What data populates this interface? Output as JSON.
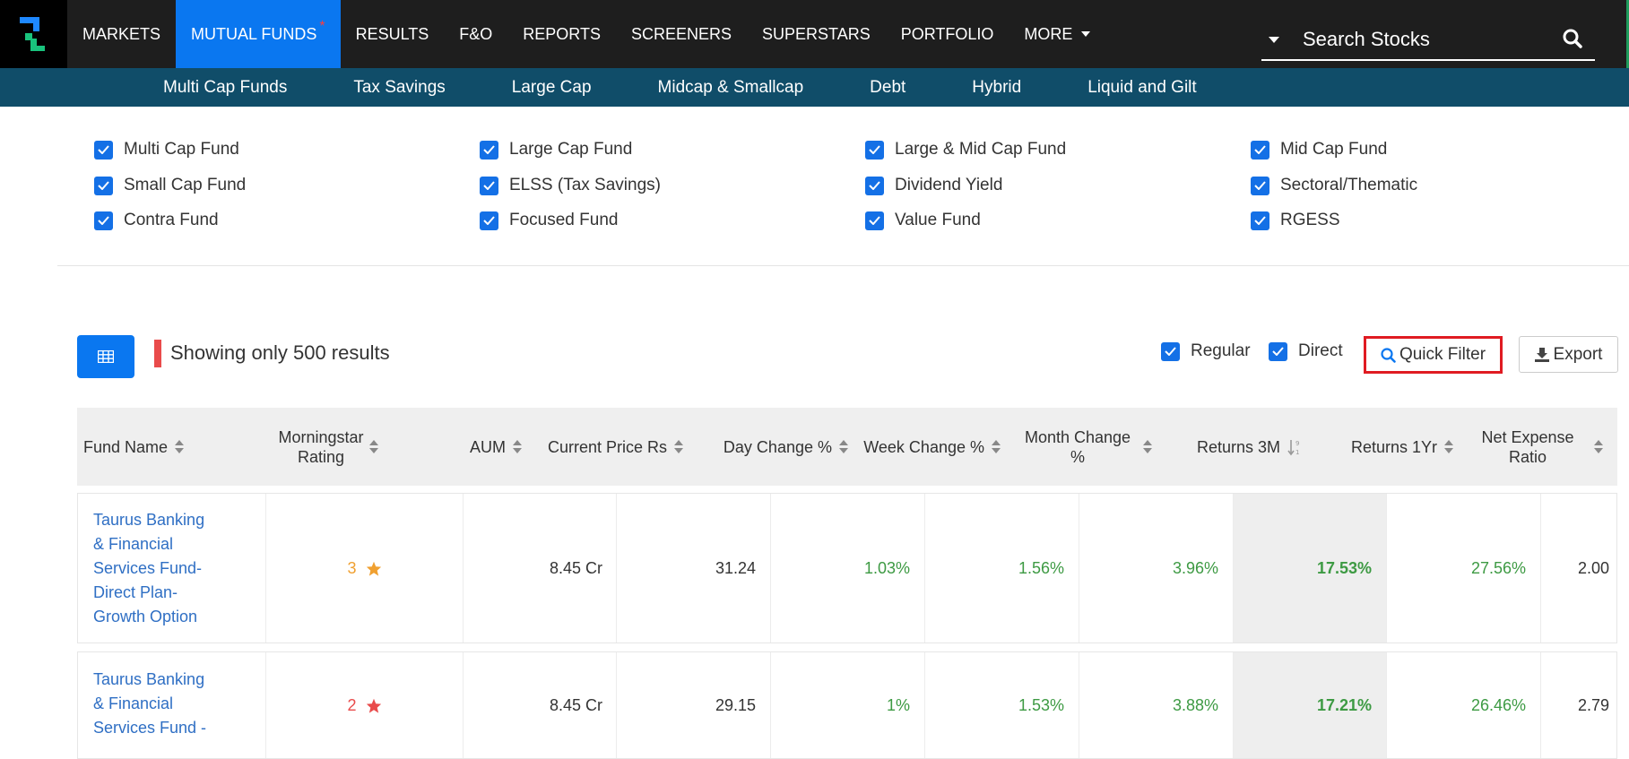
{
  "nav": {
    "items": [
      {
        "label": "MARKETS",
        "active": false
      },
      {
        "label": "MUTUAL FUNDS",
        "active": true,
        "badge": "*"
      },
      {
        "label": "RESULTS",
        "active": false
      },
      {
        "label": "F&O",
        "active": false
      },
      {
        "label": "REPORTS",
        "active": false
      },
      {
        "label": "SCREENERS",
        "active": false
      },
      {
        "label": "SUPERSTARS",
        "active": false
      },
      {
        "label": "PORTFOLIO",
        "active": false
      },
      {
        "label": "MORE",
        "active": false,
        "dropdown": true
      }
    ],
    "search_placeholder": "Search Stocks"
  },
  "subnav": {
    "items": [
      "Multi Cap Funds",
      "Tax Savings",
      "Large Cap",
      "Midcap & Smallcap",
      "Debt",
      "Hybrid",
      "Liquid and Gilt"
    ]
  },
  "categories": [
    {
      "label": "Multi Cap Fund",
      "checked": true
    },
    {
      "label": "Large Cap Fund",
      "checked": true
    },
    {
      "label": "Large & Mid Cap Fund",
      "checked": true
    },
    {
      "label": "Mid Cap Fund",
      "checked": true
    },
    {
      "label": "Small Cap Fund",
      "checked": true
    },
    {
      "label": "ELSS (Tax Savings)",
      "checked": true
    },
    {
      "label": "Dividend Yield",
      "checked": true
    },
    {
      "label": "Sectoral/Thematic",
      "checked": true
    },
    {
      "label": "Contra Fund",
      "checked": true
    },
    {
      "label": "Focused Fund",
      "checked": true
    },
    {
      "label": "Value Fund",
      "checked": true
    },
    {
      "label": "RGESS",
      "checked": true
    }
  ],
  "toolbar": {
    "results_text": "Showing only 500 results",
    "regular_label": "Regular",
    "direct_label": "Direct",
    "quick_filter_label": "Quick Filter",
    "export_label": "Export"
  },
  "table": {
    "columns": [
      {
        "label": "Fund Name"
      },
      {
        "label": "Morningstar Rating"
      },
      {
        "label": "AUM"
      },
      {
        "label": "Current Price Rs"
      },
      {
        "label": "Day Change %"
      },
      {
        "label": "Week Change %"
      },
      {
        "label": "Month Change %"
      },
      {
        "label": "Returns 3M",
        "sorted": "asc"
      },
      {
        "label": "Returns 1Yr"
      },
      {
        "label": "Net Expense Ratio"
      }
    ],
    "rows": [
      {
        "fund_name": "Taurus Banking & Financial Services Fund-Direct Plan-Growth Option",
        "fund_lines": [
          "Taurus Banking",
          "& Financial",
          "Services Fund-",
          "Direct Plan-",
          "Growth Option"
        ],
        "rating": "3",
        "rating_color": "#f0a030",
        "aum": "8.45 Cr",
        "price": "31.24",
        "day": "1.03%",
        "week": "1.56%",
        "month": "3.96%",
        "ret3m": "17.53%",
        "ret1y": "27.56%",
        "expense": "2.00"
      },
      {
        "fund_name": "Taurus Banking & Financial Services Fund -",
        "fund_lines": [
          "Taurus Banking",
          "& Financial",
          "Services Fund -"
        ],
        "rating": "2",
        "rating_color": "#e94b4b",
        "aum": "8.45 Cr",
        "price": "29.15",
        "day": "1%",
        "week": "1.53%",
        "month": "3.88%",
        "ret3m": "17.21%",
        "ret1y": "26.46%",
        "expense": "2.79"
      }
    ]
  }
}
